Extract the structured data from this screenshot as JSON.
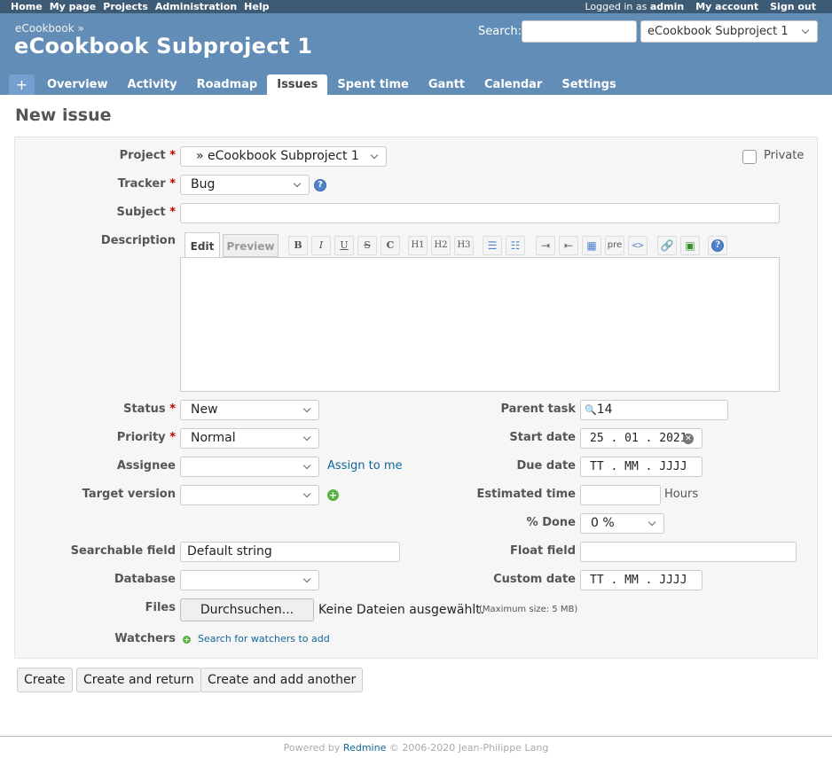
{
  "top_menu": {
    "home": "Home",
    "my_page": "My page",
    "projects": "Projects",
    "administration": "Administration",
    "help": "Help",
    "logged_prefix": "Logged in as",
    "user": "admin",
    "my_account": "My account",
    "sign_out": "Sign out"
  },
  "header": {
    "parent": "eCookbook »",
    "title": "eCookbook Subproject 1",
    "search_label": "Search:",
    "jump_value": "eCookbook Subproject 1"
  },
  "tabs": [
    {
      "label": "Overview"
    },
    {
      "label": "Activity"
    },
    {
      "label": "Roadmap"
    },
    {
      "label": "Issues"
    },
    {
      "label": "Spent time"
    },
    {
      "label": "Gantt"
    },
    {
      "label": "Calendar"
    },
    {
      "label": "Settings"
    }
  ],
  "page": {
    "title": "New issue"
  },
  "form": {
    "project_label": "Project",
    "project_value": "» eCookbook Subproject 1",
    "private_label": "Private",
    "tracker_label": "Tracker",
    "tracker_value": "Bug",
    "subject_label": "Subject",
    "description_label": "Description",
    "tab_edit": "Edit",
    "tab_preview": "Preview",
    "toolbar": {
      "h1": "H1",
      "h2": "H2",
      "h3": "H3",
      "pre": "pre"
    },
    "status_label": "Status",
    "status_value": "New",
    "priority_label": "Priority",
    "priority_value": "Normal",
    "assignee_label": "Assignee",
    "assign_to_me": "Assign to me",
    "target_label": "Target version",
    "parent_label": "Parent task",
    "parent_value": "14",
    "start_label": "Start date",
    "start_value": "25 . 01 . 2021",
    "due_label": "Due date",
    "due_placeholder": "TT . MM . JJJJ",
    "est_label": "Estimated time",
    "hours": "Hours",
    "done_label": "% Done",
    "done_value": "0 %",
    "searchable_label": "Searchable field",
    "searchable_value": "Default string",
    "float_label": "Float field",
    "database_label": "Database",
    "custom_date_label": "Custom date",
    "custom_date_placeholder": "TT . MM . JJJJ",
    "files_label": "Files",
    "browse": "Durchsuchen...",
    "no_files": "Keine Dateien ausgewählt.",
    "max_size": "(Maximum size: 5 MB)",
    "watchers_label": "Watchers",
    "watchers_link": "Search for watchers to add"
  },
  "buttons": {
    "create": "Create",
    "create_return": "Create and return",
    "create_another": "Create and add another"
  },
  "footer": {
    "prefix": "Powered by",
    "link": "Redmine",
    "suffix": "© 2006-2020 Jean-Philippe Lang"
  }
}
